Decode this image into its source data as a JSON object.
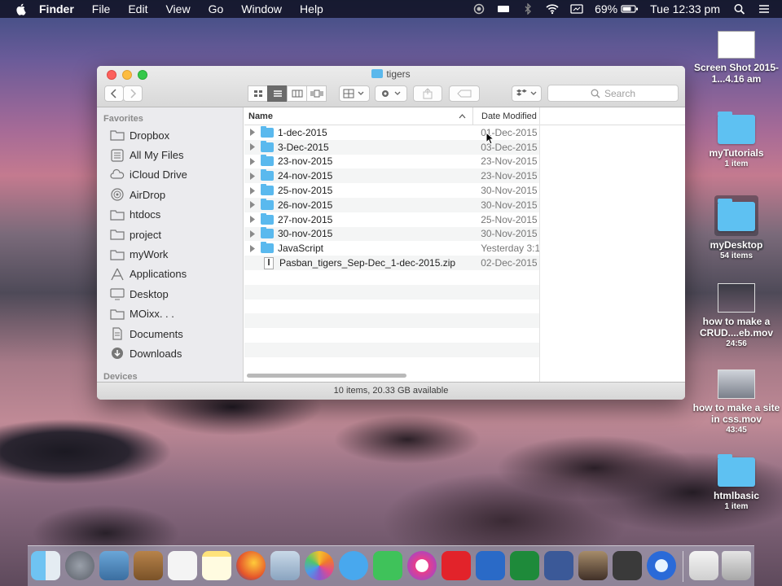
{
  "menubar": {
    "app": "Finder",
    "items": [
      "File",
      "Edit",
      "View",
      "Go",
      "Window",
      "Help"
    ],
    "battery": "69%",
    "clock": "Tue 12:33 pm"
  },
  "window": {
    "title": "tigers",
    "search_placeholder": "Search",
    "status": "10 items, 20.33 GB available"
  },
  "sidebar": {
    "favorites_header": "Favorites",
    "items": [
      {
        "label": "Dropbox",
        "icon": "folder-icon"
      },
      {
        "label": "All My Files",
        "icon": "all-files-icon"
      },
      {
        "label": "iCloud Drive",
        "icon": "cloud-icon"
      },
      {
        "label": "AirDrop",
        "icon": "airdrop-icon"
      },
      {
        "label": "htdocs",
        "icon": "folder-icon"
      },
      {
        "label": "project",
        "icon": "folder-icon"
      },
      {
        "label": "myWork",
        "icon": "folder-icon"
      },
      {
        "label": "Applications",
        "icon": "applications-icon"
      },
      {
        "label": "Desktop",
        "icon": "desktop-icon"
      },
      {
        "label": "MOixx. . .",
        "icon": "folder-icon"
      },
      {
        "label": "Documents",
        "icon": "documents-icon"
      },
      {
        "label": "Downloads",
        "icon": "downloads-icon"
      }
    ],
    "devices_header": "Devices"
  },
  "list": {
    "col_name": "Name",
    "col_date": "Date Modified",
    "rows": [
      {
        "name": "1-dec-2015",
        "date": "01-Dec-2015",
        "kind": "folder"
      },
      {
        "name": "3-Dec-2015",
        "date": "03-Dec-2015",
        "kind": "folder"
      },
      {
        "name": "23-nov-2015",
        "date": "23-Nov-2015",
        "kind": "folder"
      },
      {
        "name": "24-nov-2015",
        "date": "23-Nov-2015",
        "kind": "folder"
      },
      {
        "name": "25-nov-2015",
        "date": "30-Nov-2015",
        "kind": "folder"
      },
      {
        "name": "26-nov-2015",
        "date": "30-Nov-2015",
        "kind": "folder"
      },
      {
        "name": "27-nov-2015",
        "date": "25-Nov-2015",
        "kind": "folder"
      },
      {
        "name": "30-nov-2015",
        "date": "30-Nov-2015",
        "kind": "folder"
      },
      {
        "name": "JavaScript",
        "date": "Yesterday 3:1",
        "kind": "folder"
      },
      {
        "name": "Pasban_tigers_Sep-Dec_1-dec-2015.zip",
        "date": "02-Dec-2015",
        "kind": "zip"
      }
    ]
  },
  "desktop": {
    "icons": [
      {
        "label": "Screen Shot 2015-1...4.16 am",
        "sub": ""
      },
      {
        "label": "myTutorials",
        "sub": "1 item"
      },
      {
        "label": "myDesktop",
        "sub": "54 items"
      },
      {
        "label": "how to make a CRUD....eb.mov",
        "sub": "24:56"
      },
      {
        "label": "how to make a site in css.mov",
        "sub": "43:45"
      },
      {
        "label": "htmlbasic",
        "sub": "1 item"
      }
    ]
  }
}
